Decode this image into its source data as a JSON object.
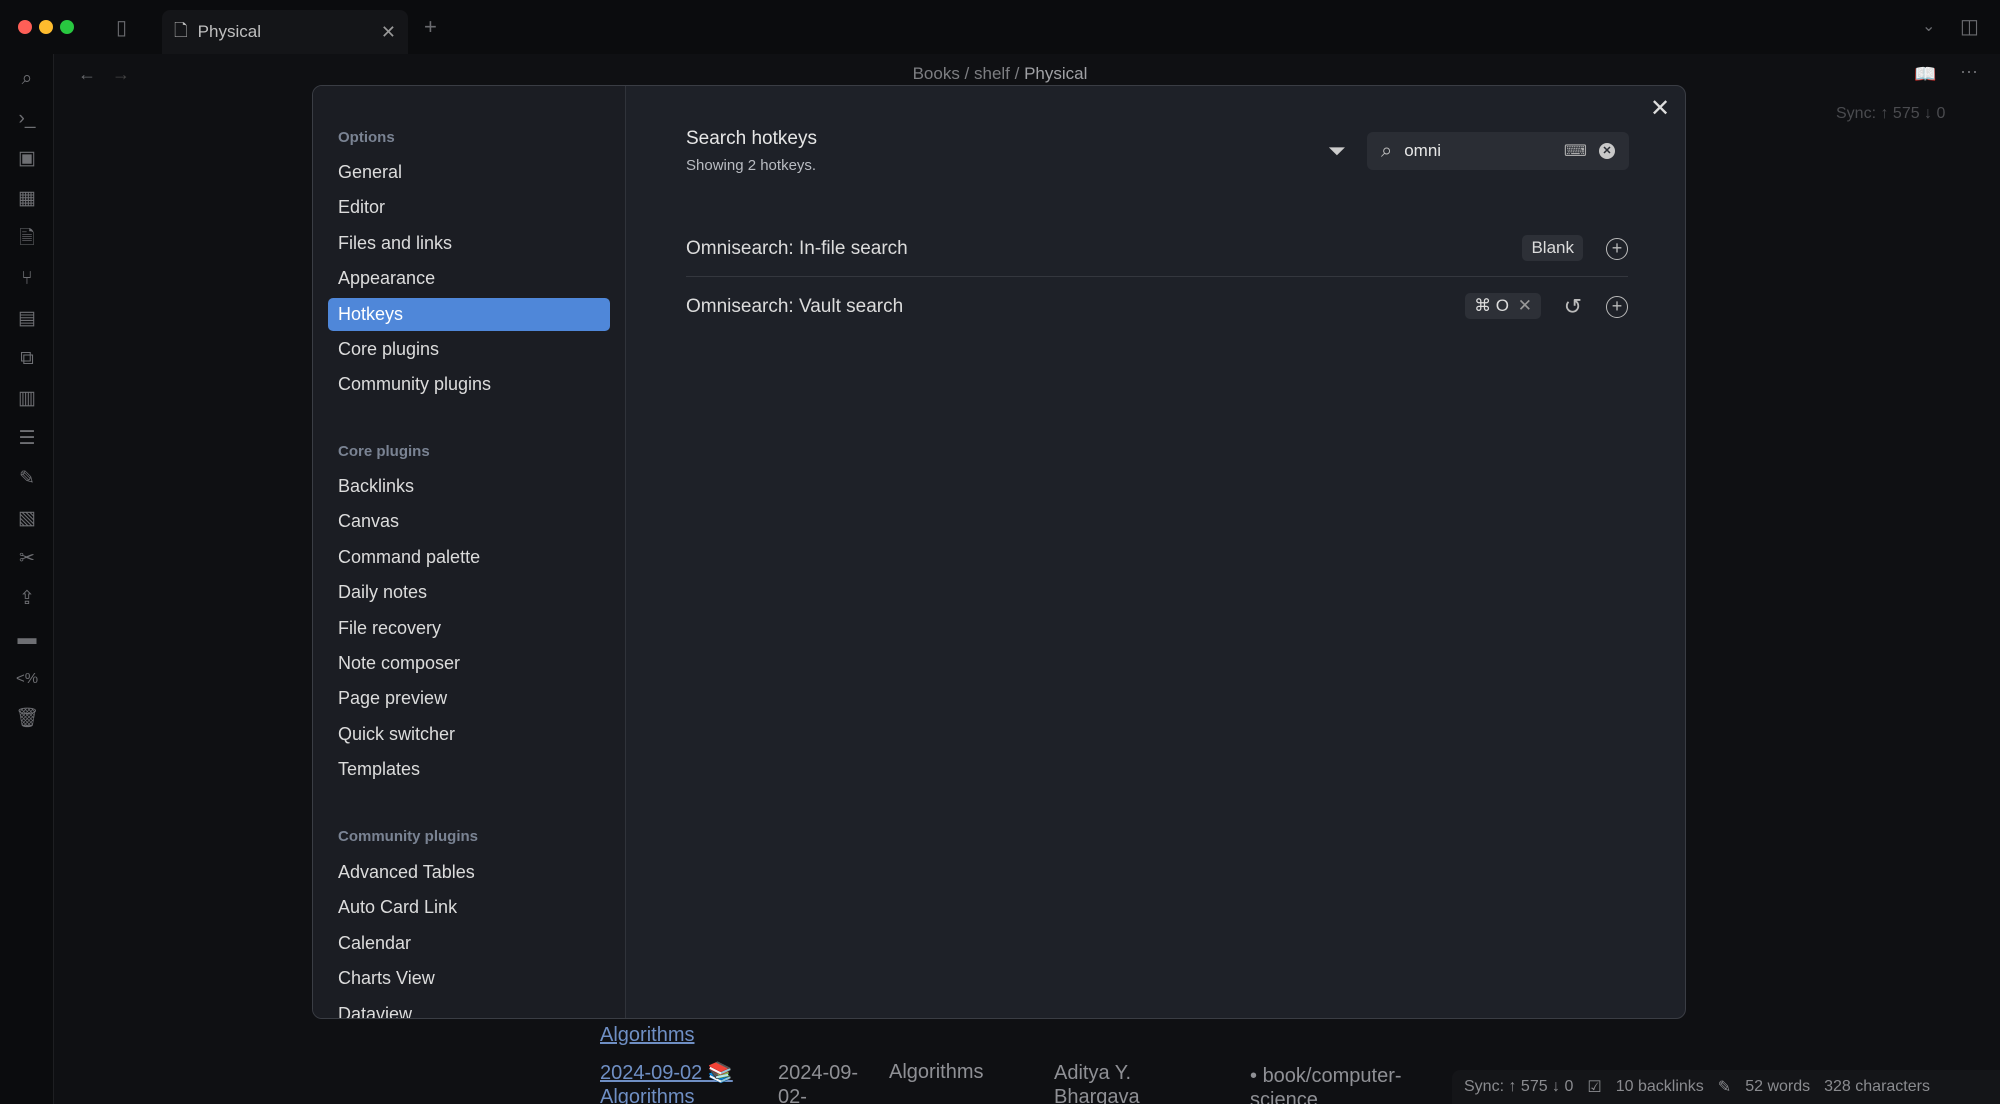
{
  "window": {
    "tab_title": "Physical",
    "breadcrumb": [
      "Books",
      "shelf",
      "Physical"
    ],
    "sync_top": "Sync:",
    "sync_counts_top": "↑ 575 ↓ 0"
  },
  "settings": {
    "sections": [
      {
        "header": "Options",
        "items": [
          "General",
          "Editor",
          "Files and links",
          "Appearance",
          "Hotkeys",
          "Core plugins",
          "Community plugins"
        ]
      },
      {
        "header": "Core plugins",
        "items": [
          "Backlinks",
          "Canvas",
          "Command palette",
          "Daily notes",
          "File recovery",
          "Note composer",
          "Page preview",
          "Quick switcher",
          "Templates"
        ]
      },
      {
        "header": "Community plugins",
        "items": [
          "Advanced Tables",
          "Auto Card Link",
          "Calendar",
          "Charts View",
          "Dataview"
        ]
      }
    ],
    "active_item": "Hotkeys",
    "accent": "#4f87d9",
    "title": "Search hotkeys",
    "subtitle": "Showing 2 hotkeys.",
    "search_value": "omni",
    "hotkeys": [
      {
        "name": "Omnisearch: In-file search",
        "binding": "Blank"
      },
      {
        "name": "Omnisearch: Vault search",
        "binding": "⌘ O"
      }
    ]
  },
  "background_table": {
    "prev_link": "Algorithms",
    "row": {
      "link": "2024-09-02 📚 Algorithms",
      "date": "2024-09-02-",
      "title": "Algorithms",
      "author": "Aditya Y. Bhargava",
      "tag": "book/computer-science"
    }
  },
  "status_bar": {
    "sync": "Sync:",
    "counts": "↑ 575 ↓ 0",
    "backlinks": "10 backlinks",
    "words": "52 words",
    "characters": "328 characters"
  }
}
